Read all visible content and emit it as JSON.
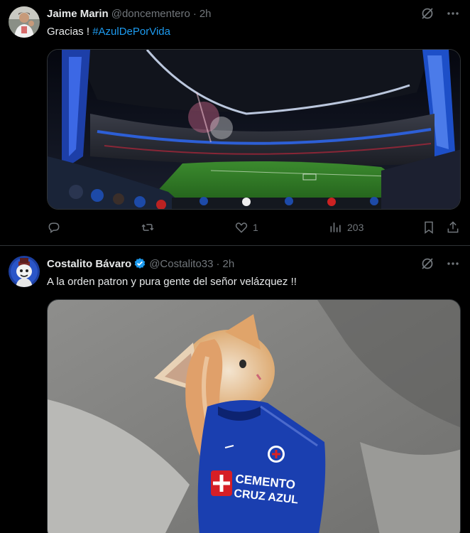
{
  "tweets": [
    {
      "name": "Jaime Marin",
      "handle": "@doncementero",
      "time": "2h",
      "text": "Gracias ! ",
      "hashtag": "#AzulDePorVida",
      "verified": false,
      "media": "stadium-photo",
      "actions": {
        "replies": "",
        "retweets": "",
        "likes": "1",
        "views": "203"
      }
    },
    {
      "name": "Costalito Bávaro",
      "handle": "@Costalito33",
      "time": "2h",
      "text": "A la orden patron y pura gente del señor velázquez !!",
      "verified": true,
      "media": "cat-in-jersey-photo",
      "jersey_text": [
        "CEMENTO",
        "CRUZ AZUL"
      ]
    }
  ],
  "separator": "·",
  "colors": {
    "background": "#000000",
    "text_primary": "#e7e9ea",
    "text_secondary": "#71767b",
    "accent": "#1d9bf0",
    "divider": "#2f3336"
  },
  "icons": [
    "grok-icon",
    "more-icon",
    "reply-icon",
    "retweet-icon",
    "like-icon",
    "views-icon",
    "bookmark-icon",
    "share-icon",
    "verified-icon"
  ]
}
